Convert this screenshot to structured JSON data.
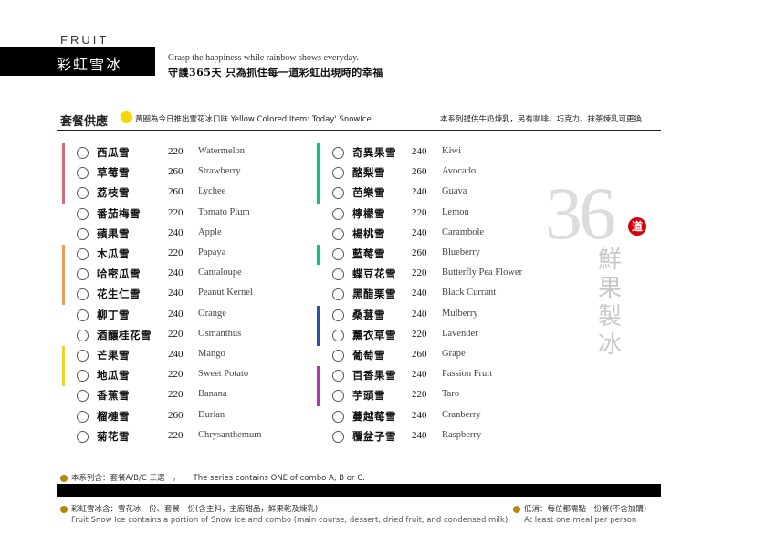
{
  "header": {
    "fruit_label": "FRUIT",
    "title": "彩虹雪冰",
    "tagline_en": "Grasp the happiness while rainbow shows everyday.",
    "tagline_zh": "守護365天 只為抓住每一道彩虹出現時的幸福"
  },
  "combo": {
    "title": "套餐供應",
    "yellow_note": "黃圈為今日推出雪花冰口味  Yellow Colored Item: Today' SnowIce",
    "right_note": "本系列提供牛奶煉乳，另有咖啡、巧克力、抹茶煉乳可更換"
  },
  "colors": {
    "yellow_dot": "#f5d800",
    "gold_dot": "#b8860b",
    "badge_red": "#d7000f",
    "stripes": [
      "#e8627a",
      "#f0a03a",
      "#f5d800",
      "#30b08a",
      "#3050a0",
      "#a040a0"
    ]
  },
  "menu_left": [
    {
      "zh": "西瓜雪",
      "price": "220",
      "en": "Watermelon",
      "stripe": "#e8627a"
    },
    {
      "zh": "草莓雪",
      "price": "260",
      "en": "Strawberry",
      "stripe": "#e8627a"
    },
    {
      "zh": "荔枝雪",
      "price": "260",
      "en": "Lychee",
      "stripe": "#e8627a"
    },
    {
      "zh": "番茄梅雪",
      "price": "220",
      "en": "Tomato Plum",
      "stripe": ""
    },
    {
      "zh": "蘋果雪",
      "price": "240",
      "en": "Apple",
      "stripe": ""
    },
    {
      "zh": "木瓜雪",
      "price": "220",
      "en": "Papaya",
      "stripe": "#f0a03a"
    },
    {
      "zh": "哈密瓜雪",
      "price": "240",
      "en": "Cantaloupe",
      "stripe": "#f0a03a"
    },
    {
      "zh": "花生仁雪",
      "price": "240",
      "en": "Peanut Kernel",
      "stripe": "#f0a03a"
    },
    {
      "zh": "柳丁雪",
      "price": "240",
      "en": "Orange",
      "stripe": ""
    },
    {
      "zh": "酒釀桂花雪",
      "price": "220",
      "en": "Osmanthus",
      "stripe": ""
    },
    {
      "zh": "芒果雪",
      "price": "240",
      "en": "Mango",
      "stripe": "#f5d800"
    },
    {
      "zh": "地瓜雪",
      "price": "220",
      "en": "Sweet Potato",
      "stripe": "#f5d800"
    },
    {
      "zh": "香蕉雪",
      "price": "220",
      "en": "Banana",
      "stripe": ""
    },
    {
      "zh": "榴槤雪",
      "price": "260",
      "en": "Durian",
      "stripe": ""
    },
    {
      "zh": "菊花雪",
      "price": "220",
      "en": "Chrysanthemum",
      "stripe": ""
    }
  ],
  "menu_right": [
    {
      "zh": "奇異果雪",
      "price": "240",
      "en": "Kiwi",
      "stripe": "#30b08a"
    },
    {
      "zh": "酪梨雪",
      "price": "260",
      "en": "Avocado",
      "stripe": "#30b08a"
    },
    {
      "zh": "芭樂雪",
      "price": "240",
      "en": "Guava",
      "stripe": "#30b08a"
    },
    {
      "zh": "檸檬雪",
      "price": "220",
      "en": "Lemon",
      "stripe": ""
    },
    {
      "zh": "楊桃雪",
      "price": "240",
      "en": "Carambole",
      "stripe": ""
    },
    {
      "zh": "藍莓雪",
      "price": "260",
      "en": "Blueberry",
      "stripe": "#30b08a"
    },
    {
      "zh": "蝶豆花雪",
      "price": "220",
      "en": "Butterfly Pea Flower",
      "stripe": ""
    },
    {
      "zh": "黑醋栗雪",
      "price": "240",
      "en": "Black Currant",
      "stripe": ""
    },
    {
      "zh": "桑葚雪",
      "price": "240",
      "en": "Mulberry",
      "stripe": "#3050a0"
    },
    {
      "zh": "薰衣草雪",
      "price": "220",
      "en": "Lavender",
      "stripe": "#3050a0"
    },
    {
      "zh": "葡萄雪",
      "price": "260",
      "en": "Grape",
      "stripe": ""
    },
    {
      "zh": "百香果雪",
      "price": "240",
      "en": "Passion Fruit",
      "stripe": "#a040a0"
    },
    {
      "zh": "芋頭雪",
      "price": "220",
      "en": "Taro",
      "stripe": "#a040a0"
    },
    {
      "zh": "蔓越莓雪",
      "price": "240",
      "en": "Cranberry",
      "stripe": ""
    },
    {
      "zh": "覆盆子雪",
      "price": "240",
      "en": "Raspberry",
      "stripe": ""
    }
  ],
  "decoration": {
    "big_number": "36",
    "badge": "道",
    "vertical_title": "鮮果製冰"
  },
  "footer": {
    "series_zh": "本系列含：套餐A/B/C 三選一。",
    "series_en": "The series contains ONE of combo A, B or C.",
    "left_zh": "彩虹雪冰含：雪花冰一份、套餐一份(含主料，主廚甜品，鮮果乾及煉乳)",
    "left_en": "Fruit Snow Ice contains a portion of Snow Ice and combo (main course, dessert, dried fruit, and condensed milk).",
    "right_zh": "低消：每位都需點一份餐(不含加購)",
    "right_en": "At least one meal per person"
  }
}
